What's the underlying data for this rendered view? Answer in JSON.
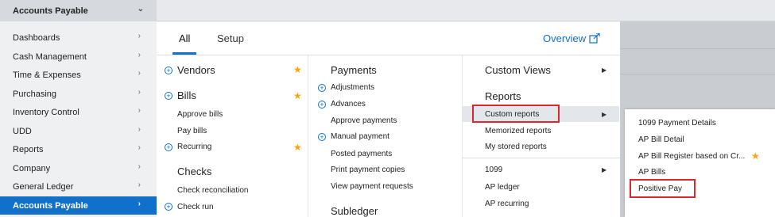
{
  "topbar": {
    "module": "Accounts Payable"
  },
  "sidebar": {
    "items": [
      {
        "label": "Dashboards"
      },
      {
        "label": "Cash Management"
      },
      {
        "label": "Time & Expenses"
      },
      {
        "label": "Purchasing"
      },
      {
        "label": "Inventory Control"
      },
      {
        "label": "UDD"
      },
      {
        "label": "Reports"
      },
      {
        "label": "Company"
      },
      {
        "label": "General Ledger"
      },
      {
        "label": "Accounts Payable",
        "active": true
      }
    ]
  },
  "tabs": {
    "all": "All",
    "setup": "Setup",
    "overview": "Overview"
  },
  "col1": {
    "vendors": "Vendors",
    "bills": "Bills",
    "approve_bills": "Approve bills",
    "pay_bills": "Pay bills",
    "recurring": "Recurring",
    "checks": "Checks",
    "check_reconciliation": "Check reconciliation",
    "check_run": "Check run"
  },
  "col2": {
    "payments": "Payments",
    "adjustments": "Adjustments",
    "advances": "Advances",
    "approve_payments": "Approve payments",
    "manual_payment": "Manual payment",
    "posted_payments": "Posted payments",
    "print_payment_copies": "Print payment copies",
    "view_payment_requests": "View payment requests",
    "subledger": "Subledger"
  },
  "col3": {
    "custom_views": "Custom Views",
    "reports": "Reports",
    "custom_reports": "Custom reports",
    "memorized_reports": "Memorized reports",
    "my_stored_reports": "My stored reports",
    "r1099": "1099",
    "ap_ledger": "AP ledger",
    "ap_recurring": "AP recurring"
  },
  "flyout": {
    "items": [
      "1099 Payment Details",
      "AP Bill Detail",
      "AP Bill Register based on Cr...",
      "AP Bills",
      "Positive Pay"
    ]
  },
  "colors": {
    "accent": "#1170c9",
    "star": "#f2a515",
    "highlight": "#d9292e"
  }
}
